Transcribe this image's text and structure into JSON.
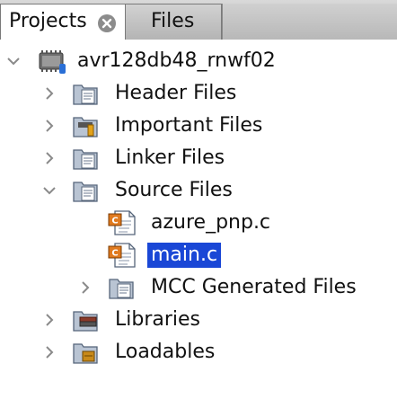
{
  "tabs": {
    "projects": "Projects",
    "files": "Files"
  },
  "tree": {
    "project": "avr128db48_rnwf02",
    "header_files": "Header Files",
    "important_files": "Important Files",
    "linker_files": "Linker Files",
    "source_files": "Source Files",
    "azure_pnp": "azure_pnp.c",
    "main_c": "main.c",
    "mcc_generated": "MCC Generated Files",
    "libraries": "Libraries",
    "loadables": "Loadables"
  },
  "icons": {
    "project": "chip-project-icon",
    "folder": "folder-icon",
    "c_file": "c-source-file-icon"
  },
  "colors": {
    "selection": "#1a47d6",
    "folder": "#b9c4d3",
    "c_badge": "#e07a1f"
  }
}
